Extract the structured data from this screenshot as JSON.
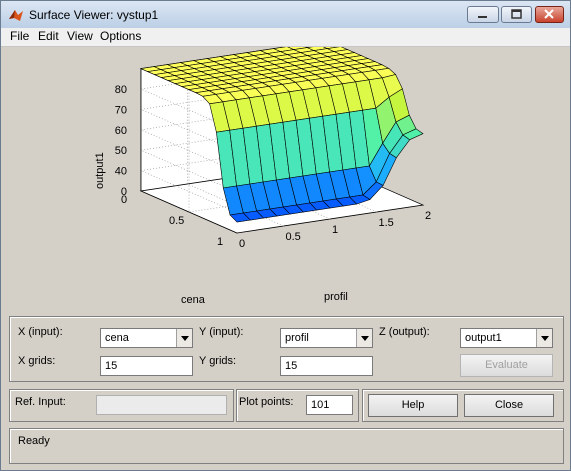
{
  "window": {
    "title": "Surface Viewer: vystup1"
  },
  "menu": [
    "File",
    "Edit",
    "View",
    "Options"
  ],
  "chart_data": {
    "type": "surface",
    "title": "",
    "x_axis": {
      "label": "profil",
      "range": [
        0,
        2
      ],
      "ticks": [
        "0",
        "0.5",
        "1",
        "1.5",
        "2"
      ]
    },
    "y_axis": {
      "label": "cena",
      "range": [
        0,
        1
      ],
      "ticks": [
        "0",
        "0.5",
        "1"
      ]
    },
    "z_axis": {
      "label": "output1",
      "range": [
        30,
        90
      ],
      "ticks": [
        "0",
        "40",
        "50",
        "60",
        "70",
        "80"
      ]
    },
    "grid": true
  },
  "controls": {
    "x_input_label": "X (input):",
    "x_input_value": "cena",
    "y_input_label": "Y (input):",
    "y_input_value": "profil",
    "z_output_label": "Z (output):",
    "z_output_value": "output1",
    "x_grids_label": "X grids:",
    "x_grids_value": "15",
    "y_grids_label": "Y grids:",
    "y_grids_value": "15",
    "evaluate_label": "Evaluate",
    "ref_input_label": "Ref. Input:",
    "ref_input_value": "",
    "plot_points_label": "Plot points:",
    "plot_points_value": "101",
    "help_label": "Help",
    "close_label": "Close"
  },
  "status": "Ready"
}
